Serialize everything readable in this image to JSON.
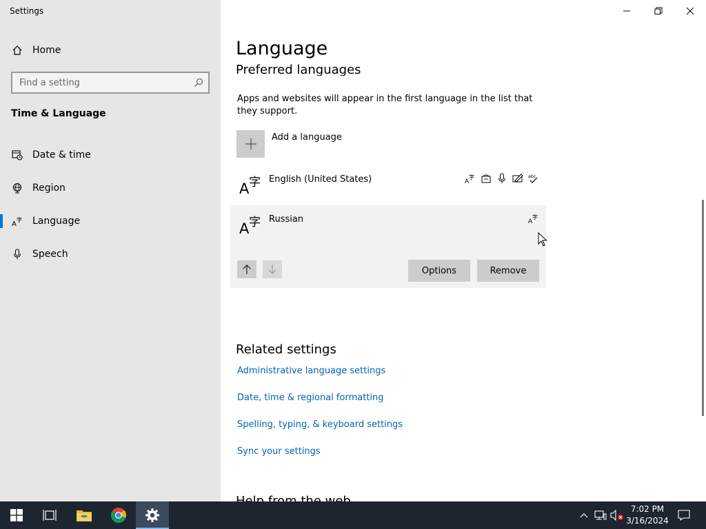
{
  "window": {
    "title": "Settings"
  },
  "sidebar": {
    "home_label": "Home",
    "search_placeholder": "Find a setting",
    "section_title": "Time & Language",
    "items": [
      {
        "label": "Date & time",
        "icon": "calendar-clock-icon"
      },
      {
        "label": "Region",
        "icon": "globe-icon"
      },
      {
        "label": "Language",
        "icon": "language-icon",
        "active": true
      },
      {
        "label": "Speech",
        "icon": "microphone-icon"
      }
    ]
  },
  "main": {
    "title": "Language",
    "preferred_title": "Preferred languages",
    "description": "Apps and websites will appear in the first language in the list that they support.",
    "add_language_label": "Add a language",
    "languages": [
      {
        "name": "English (United States)",
        "features": [
          "display-language-icon",
          "text-to-speech-icon",
          "speech-recognition-icon",
          "handwriting-icon",
          "spell-check-icon"
        ]
      },
      {
        "name": "Russian",
        "features": [
          "display-language-icon"
        ],
        "selected": true
      }
    ],
    "buttons": {
      "options": "Options",
      "remove": "Remove"
    },
    "related_title": "Related settings",
    "related_links": [
      "Administrative language settings",
      "Date, time & regional formatting",
      "Spelling, typing, & keyboard settings",
      "Sync your settings"
    ],
    "help_title": "Help from the web"
  },
  "taskbar": {
    "time": "7:02 PM",
    "date": "3/16/2024",
    "apps": [
      "start-icon",
      "task-view-icon",
      "file-explorer-icon",
      "chrome-icon",
      "settings-icon"
    ]
  },
  "colors": {
    "accent": "#0078d7",
    "link": "#0063b1",
    "taskbar": "#1c2530"
  }
}
